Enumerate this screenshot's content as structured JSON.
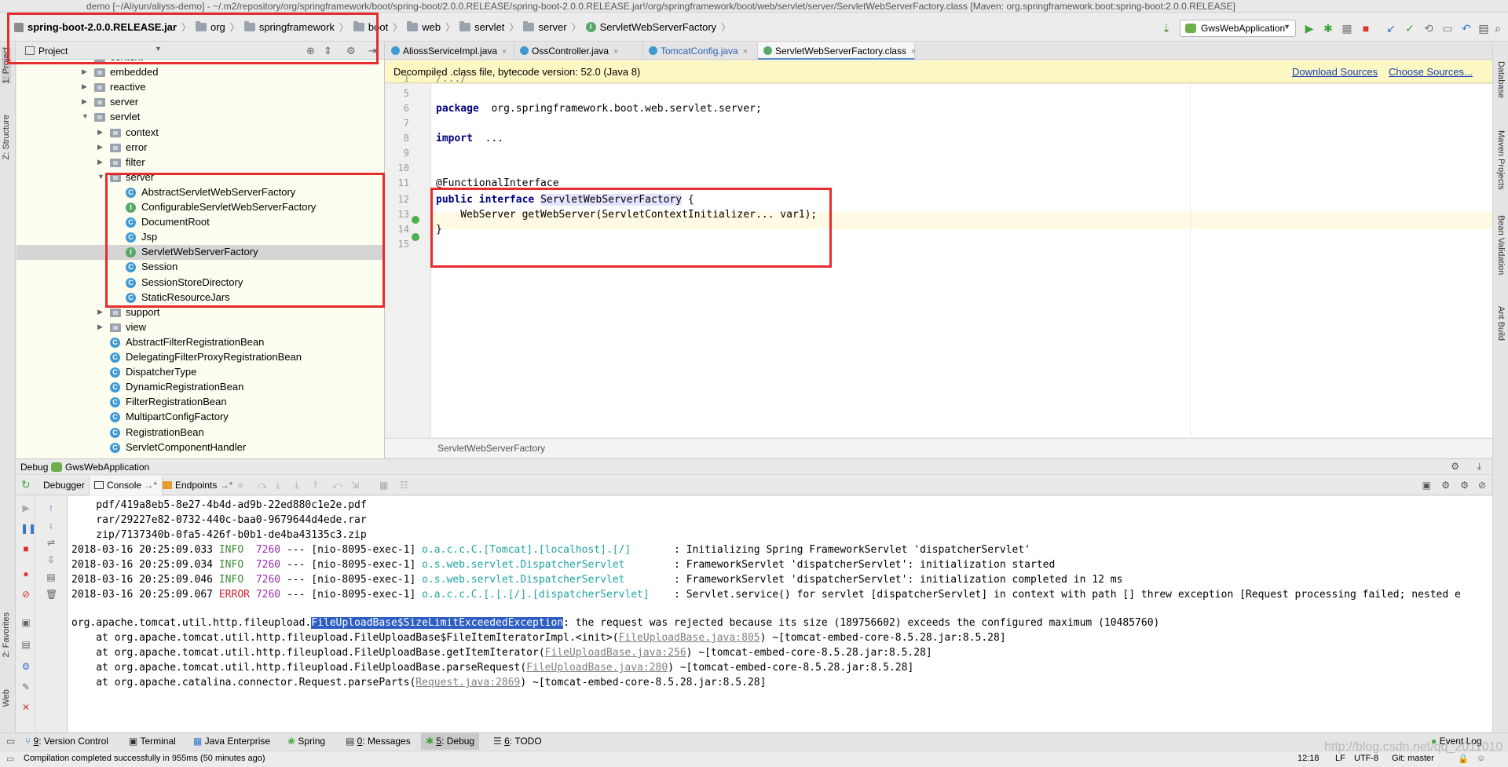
{
  "window": {
    "title": "demo [~/Aliyun/aliyss-demo] - ~/.m2/repository/org/springframework/boot/spring-boot/2.0.0.RELEASE/spring-boot-2.0.0.RELEASE.jar!/org/springframework/boot/web/servlet/server/ServletWebServerFactory.class [Maven: org.springframework.boot:spring-boot:2.0.0.RELEASE]"
  },
  "navbar": {
    "crumbs": [
      "spring-boot-2.0.0.RELEASE.jar",
      "org",
      "springframework",
      "boot",
      "web",
      "servlet",
      "server",
      "ServletWebServerFactory"
    ],
    "run_config": "GwsWebApplication"
  },
  "left_strip": {
    "tabs": [
      "1: Project",
      "Z: Structure",
      "2: Favorites",
      "Web"
    ]
  },
  "right_strip": {
    "tabs": [
      "Database",
      "Maven Projects",
      "Bean Validation",
      "Ant Build"
    ]
  },
  "project_panel": {
    "title": "Project",
    "tree": [
      {
        "label": "context",
        "type": "folder",
        "depth": 0,
        "expanded": false
      },
      {
        "label": "embedded",
        "type": "folder",
        "depth": 0,
        "expanded": false
      },
      {
        "label": "reactive",
        "type": "folder",
        "depth": 0,
        "expanded": false
      },
      {
        "label": "server",
        "type": "folder",
        "depth": 0,
        "expanded": false
      },
      {
        "label": "servlet",
        "type": "folder",
        "depth": 0,
        "expanded": true
      },
      {
        "label": "context",
        "type": "folder",
        "depth": 1,
        "expanded": false
      },
      {
        "label": "error",
        "type": "folder",
        "depth": 1,
        "expanded": false
      },
      {
        "label": "filter",
        "type": "folder",
        "depth": 1,
        "expanded": false
      },
      {
        "label": "server",
        "type": "folder",
        "depth": 1,
        "expanded": true
      },
      {
        "label": "AbstractServletWebServerFactory",
        "type": "class",
        "depth": 2
      },
      {
        "label": "ConfigurableServletWebServerFactory",
        "type": "interface",
        "depth": 2
      },
      {
        "label": "DocumentRoot",
        "type": "class",
        "depth": 2
      },
      {
        "label": "Jsp",
        "type": "class",
        "depth": 2
      },
      {
        "label": "ServletWebServerFactory",
        "type": "interface",
        "depth": 2,
        "selected": true
      },
      {
        "label": "Session",
        "type": "class",
        "depth": 2
      },
      {
        "label": "SessionStoreDirectory",
        "type": "class",
        "depth": 2
      },
      {
        "label": "StaticResourceJars",
        "type": "class",
        "depth": 2
      },
      {
        "label": "support",
        "type": "folder",
        "depth": 1,
        "expanded": false
      },
      {
        "label": "view",
        "type": "folder",
        "depth": 1,
        "expanded": false
      },
      {
        "label": "AbstractFilterRegistrationBean",
        "type": "class",
        "depth": 1
      },
      {
        "label": "DelegatingFilterProxyRegistrationBean",
        "type": "class",
        "depth": 1
      },
      {
        "label": "DispatcherType",
        "type": "class",
        "depth": 1
      },
      {
        "label": "DynamicRegistrationBean",
        "type": "class",
        "depth": 1
      },
      {
        "label": "FilterRegistrationBean",
        "type": "class",
        "depth": 1
      },
      {
        "label": "MultipartConfigFactory",
        "type": "class",
        "depth": 1
      },
      {
        "label": "RegistrationBean",
        "type": "class",
        "depth": 1
      },
      {
        "label": "ServletComponentHandler",
        "type": "class",
        "depth": 1
      }
    ]
  },
  "editor_tabs": [
    {
      "label": "AliossServiceImpl.java",
      "icon": "class"
    },
    {
      "label": "OssController.java",
      "icon": "class"
    },
    {
      "label": "TomcatConfig.java",
      "icon": "class"
    },
    {
      "label": "ServletWebServerFactory.class",
      "icon": "interface",
      "active": true
    }
  ],
  "banner": {
    "message": "Decompiled .class file, bytecode version: 52.0 (Java 8)",
    "download_sources": "Download Sources",
    "choose_sources": "Choose Sources..."
  },
  "editor": {
    "line_numbers": [
      "1",
      "5",
      "6",
      "7",
      "8",
      "9",
      "10",
      "11",
      "12",
      "13",
      "14",
      "15"
    ],
    "lines": [
      {
        "n": "1",
        "text": "/.../"
      },
      {
        "n": "5",
        "text": ""
      },
      {
        "n": "6",
        "kw": "package",
        "text": " org.springframework.boot.web.servlet.server;"
      },
      {
        "n": "7",
        "text": ""
      },
      {
        "n": "8",
        "kw": "import",
        "text": " ..."
      },
      {
        "n": "9",
        "text": ""
      },
      {
        "n": "10",
        "text": ""
      },
      {
        "n": "11",
        "text": "@FunctionalInterface"
      },
      {
        "n": "12",
        "kw": "public interface",
        "ident": "ServletWebServerFactory",
        "text": " {"
      },
      {
        "n": "13",
        "text": "    WebServer getWebServer(ServletContextInitializer... var1);"
      },
      {
        "n": "14",
        "text": "}"
      },
      {
        "n": "15",
        "text": ""
      }
    ],
    "breadcrumb": "ServletWebServerFactory"
  },
  "debug": {
    "header_label": "Debug",
    "config": "GwsWebApplication",
    "tabs": [
      "Debugger",
      "Console",
      "Endpoints"
    ],
    "console_lines": {
      "l1": "    pdf/419a8eb5-8e27-4b4d-ad9b-22ed880c1e2e.pdf",
      "l2": "    rar/29227e82-0732-440c-baa0-9679644d4ede.rar",
      "l3": "    zip/7137340b-0fa5-426f-b0b1-de4ba43135c3.zip",
      "log": [
        {
          "ts": "2018-03-16 20:25:09.033",
          "lvl": "INFO",
          "pid": "7260",
          "mid": " --- [nio-8095-exec-1] ",
          "logger": "o.a.c.c.C.[Tomcat].[localhost].[/]      ",
          "msg": " : Initializing Spring FrameworkServlet 'dispatcherServlet'"
        },
        {
          "ts": "2018-03-16 20:25:09.034",
          "lvl": "INFO",
          "pid": "7260",
          "mid": " --- [nio-8095-exec-1] ",
          "logger": "o.s.web.servlet.DispatcherServlet       ",
          "msg": " : FrameworkServlet 'dispatcherServlet': initialization started"
        },
        {
          "ts": "2018-03-16 20:25:09.046",
          "lvl": "INFO",
          "pid": "7260",
          "mid": " --- [nio-8095-exec-1] ",
          "logger": "o.s.web.servlet.DispatcherServlet       ",
          "msg": " : FrameworkServlet 'dispatcherServlet': initialization completed in 12 ms"
        },
        {
          "ts": "2018-03-16 20:25:09.067",
          "lvl": "ERROR",
          "pid": "7260",
          "mid": " --- [nio-8095-exec-1] ",
          "logger": "o.a.c.c.C.[.[.[/].[dispatcherServlet]   ",
          "msg": " : Servlet.service() for servlet [dispatcherServlet] in context with path [] threw exception [Request processing failed; nested e"
        }
      ],
      "exc_prefix": "org.apache.tomcat.util.http.fileupload.",
      "exc_sel": "FileUploadBase$SizeLimitExceededException",
      "exc_rest": ": the request was rejected because its size (189756602) exceeds the configured maximum (10485760)",
      "stack": [
        {
          "pre": "    at org.apache.tomcat.util.http.fileupload.FileUploadBase$FileItemIteratorImpl.<init>(",
          "link": "FileUploadBase.java:805",
          "post": ") ~[tomcat-embed-core-8.5.28.jar:8.5.28]"
        },
        {
          "pre": "    at org.apache.tomcat.util.http.fileupload.FileUploadBase.getItemIterator(",
          "link": "FileUploadBase.java:256",
          "post": ") ~[tomcat-embed-core-8.5.28.jar:8.5.28]"
        },
        {
          "pre": "    at org.apache.tomcat.util.http.fileupload.FileUploadBase.parseRequest(",
          "link": "FileUploadBase.java:280",
          "post": ") ~[tomcat-embed-core-8.5.28.jar:8.5.28]"
        },
        {
          "pre": "    at org.apache.catalina.connector.Request.parseParts(",
          "link": "Request.java:2869",
          "post": ") ~[tomcat-embed-core-8.5.28.jar:8.5.28]"
        }
      ]
    }
  },
  "bottom_tools": [
    {
      "num": "9",
      "label": ": Version Control"
    },
    {
      "num": "",
      "label": "Terminal"
    },
    {
      "num": "",
      "label": "Java Enterprise"
    },
    {
      "num": "",
      "label": "Spring"
    },
    {
      "num": "0",
      "label": ": Messages"
    },
    {
      "num": "5",
      "label": ": Debug",
      "active": true
    },
    {
      "num": "6",
      "label": ": TODO"
    }
  ],
  "event_log": "Event Log",
  "status": {
    "message": "Compilation completed successfully in 955ms (50 minutes ago)",
    "position": "12:18",
    "line_sep": "LF",
    "encoding": "UTF-8",
    "git": "Git: master",
    "watermark": "http://blog.csdn.net/qq_2011010"
  },
  "colors": {
    "annotation": "#e52d2d",
    "project_bg": "#fdfdf0",
    "banner_bg": "#fdf7c3",
    "keyword": "#000080",
    "info": "#3d8b37",
    "error": "#c7222a",
    "selection": "#2d5ec2"
  }
}
